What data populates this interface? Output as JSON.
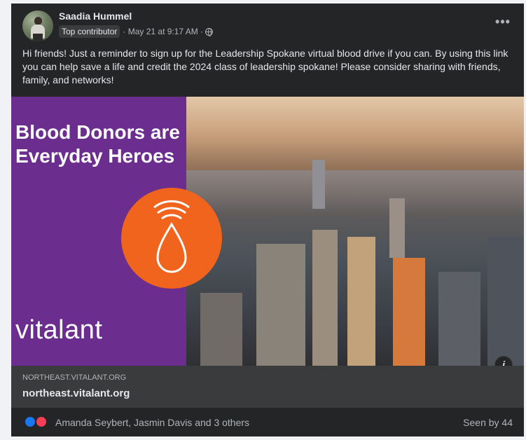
{
  "post": {
    "author": "Saadia Hummel",
    "badge": "Top contributor",
    "timestamp": "· May 21 at 9:17 AM ·",
    "more_label": "•••",
    "text": "Hi friends! Just a reminder to sign up for the Leadership Spokane virtual blood drive if you can. By using this link you can help save a life and credit the 2024 class of leadership spokane! Please consider sharing with friends, family, and networks!"
  },
  "media": {
    "headline": "Blood Donors are Everyday Heroes",
    "logo_text": "vitalant",
    "info_label": "i",
    "colors": {
      "purple": "#6b2d8e",
      "orange": "#f0641e"
    }
  },
  "link_preview": {
    "domain_caps": "NORTHEAST.VITALANT.ORG",
    "domain": "northeast.vitalant.org"
  },
  "footer": {
    "reactors": "Amanda Seybert, Jasmin Davis and 3 others",
    "seen_by": "Seen by 44"
  },
  "icons": [
    "more-icon",
    "globe-icon",
    "like-icon",
    "love-icon",
    "drop-icon",
    "info-icon"
  ]
}
